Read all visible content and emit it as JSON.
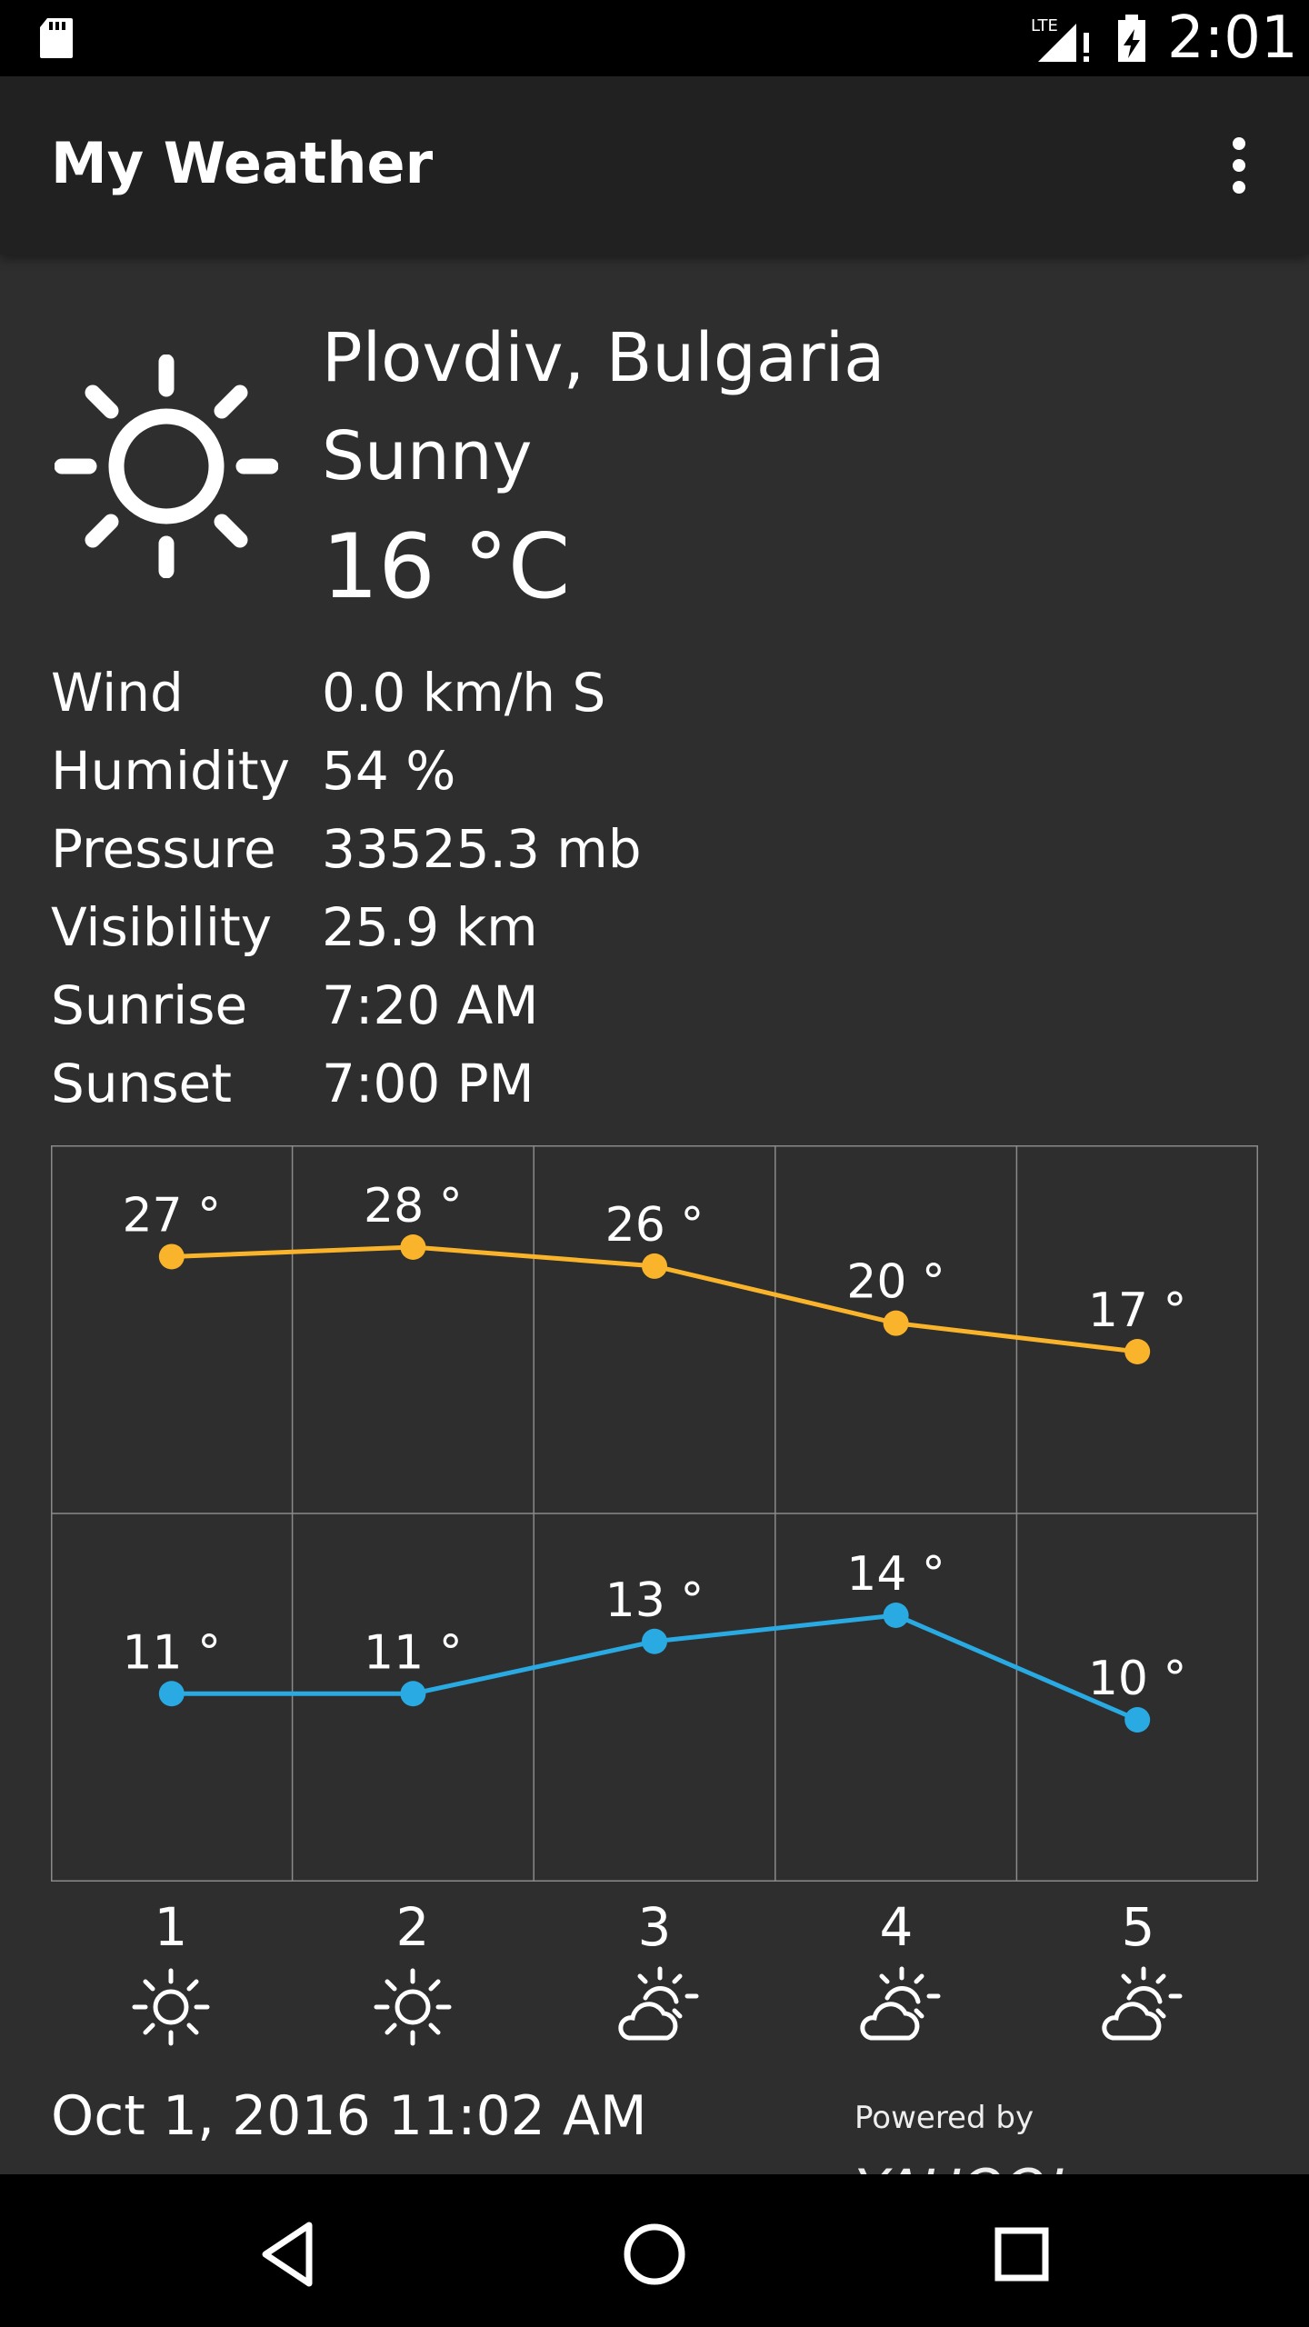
{
  "status_bar": {
    "network": "LTE",
    "time": "2:01"
  },
  "app_bar": {
    "title": "My Weather"
  },
  "current": {
    "location": "Plovdiv, Bulgaria",
    "condition": "Sunny",
    "temperature": "16 °C",
    "icon": "sun-icon"
  },
  "details": [
    {
      "label": "Wind",
      "value": "0.0 km/h S"
    },
    {
      "label": "Humidity",
      "value": "54 %"
    },
    {
      "label": "Pressure",
      "value": "33525.3 mb"
    },
    {
      "label": "Visibility",
      "value": "25.9 km"
    },
    {
      "label": "Sunrise",
      "value": "7:20 AM"
    },
    {
      "label": "Sunset",
      "value": "7:00 PM"
    }
  ],
  "chart_data": {
    "type": "line",
    "categories": [
      "1",
      "2",
      "3",
      "4",
      "5"
    ],
    "series": [
      {
        "color": "#f9b42c",
        "values": [
          27,
          28,
          26,
          20,
          17
        ],
        "labels": [
          "27 °",
          "28 °",
          "26 °",
          "20 °",
          "17 °"
        ]
      },
      {
        "color": "#2aaae2",
        "values": [
          11,
          11,
          13,
          14,
          10
        ],
        "labels": [
          "11 °",
          "11 °",
          "13 °",
          "14 °",
          "10 °"
        ]
      }
    ],
    "grid": true
  },
  "forecast": {
    "days": [
      {
        "label": "1",
        "icon": "sun-icon"
      },
      {
        "label": "2",
        "icon": "sun-icon"
      },
      {
        "label": "3",
        "icon": "partly-cloudy-icon"
      },
      {
        "label": "4",
        "icon": "partly-cloudy-icon"
      },
      {
        "label": "5",
        "icon": "partly-cloudy-icon"
      }
    ]
  },
  "footer": {
    "updated": "Oct 1, 2016 11:02 AM",
    "powered_by": "Powered by",
    "brand": "YAHOO!"
  },
  "nav": {
    "back": "back-icon",
    "home": "home-icon",
    "recents": "recents-icon"
  }
}
